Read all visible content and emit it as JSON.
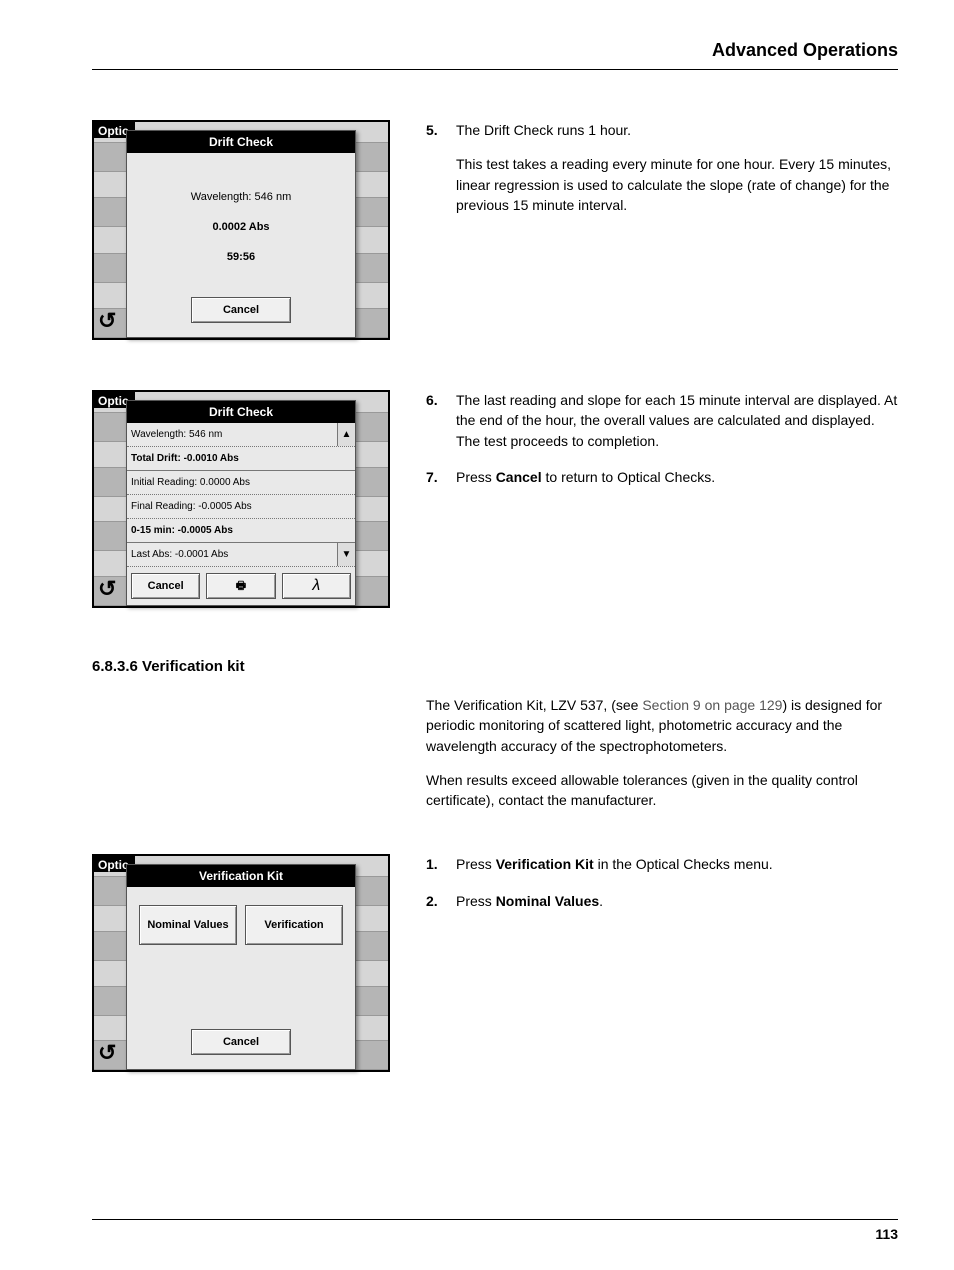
{
  "header": {
    "title": "Advanced Operations"
  },
  "page_number": "113",
  "ss_optic_label": "Optic",
  "screenshot1": {
    "dialog_title": "Drift Check",
    "wavelength": "Wavelength: 546 nm",
    "abs": "0.0002 Abs",
    "time": "59:56",
    "cancel": "Cancel"
  },
  "screenshot2": {
    "dialog_title": "Drift Check",
    "rows": {
      "r0": "Wavelength: 546 nm",
      "r1": "Total Drift: -0.0010 Abs",
      "r2": "Initial Reading:  0.0000 Abs",
      "r3": "Final Reading: -0.0005 Abs",
      "r4": "0-15 min: -0.0005 Abs",
      "r5": "Last Abs: -0.0001 Abs"
    },
    "cancel": "Cancel"
  },
  "screenshot3": {
    "dialog_title": "Verification Kit",
    "nominal": "Nominal Values",
    "verification": "Verification",
    "cancel": "Cancel"
  },
  "steps_a": {
    "s5_num": "5.",
    "s5_a": "The Drift Check runs 1 hour.",
    "s5_b": "This test takes a reading every minute for one hour. Every 15 minutes, linear regression is used to calculate the slope (rate of change) for the previous 15 minute interval."
  },
  "steps_b": {
    "s6_num": "6.",
    "s6": "The last reading and slope for each 15 minute interval are displayed. At the end of the hour, the overall values are calculated and displayed. The test proceeds to completion.",
    "s7_num": "7.",
    "s7_pre": "Press ",
    "s7_bold": "Cancel",
    "s7_post": " to return to Optical Checks."
  },
  "section": {
    "heading": "6.8.3.6  Verification kit",
    "p1_a": "The Verification Kit, LZV 537, (see ",
    "p1_link": "Section 9 on page 129",
    "p1_b": ") is designed for periodic monitoring of scattered light, photometric accuracy and the wavelength accuracy of the spectrophotometers.",
    "p2": "When results exceed allowable tolerances (given in the quality control certificate), contact the manufacturer."
  },
  "steps_c": {
    "s1_num": "1.",
    "s1_pre": "Press ",
    "s1_bold": "Verification Kit",
    "s1_post": " in the Optical Checks menu.",
    "s2_num": "2.",
    "s2_pre": "Press ",
    "s2_bold": "Nominal Values",
    "s2_post": "."
  }
}
